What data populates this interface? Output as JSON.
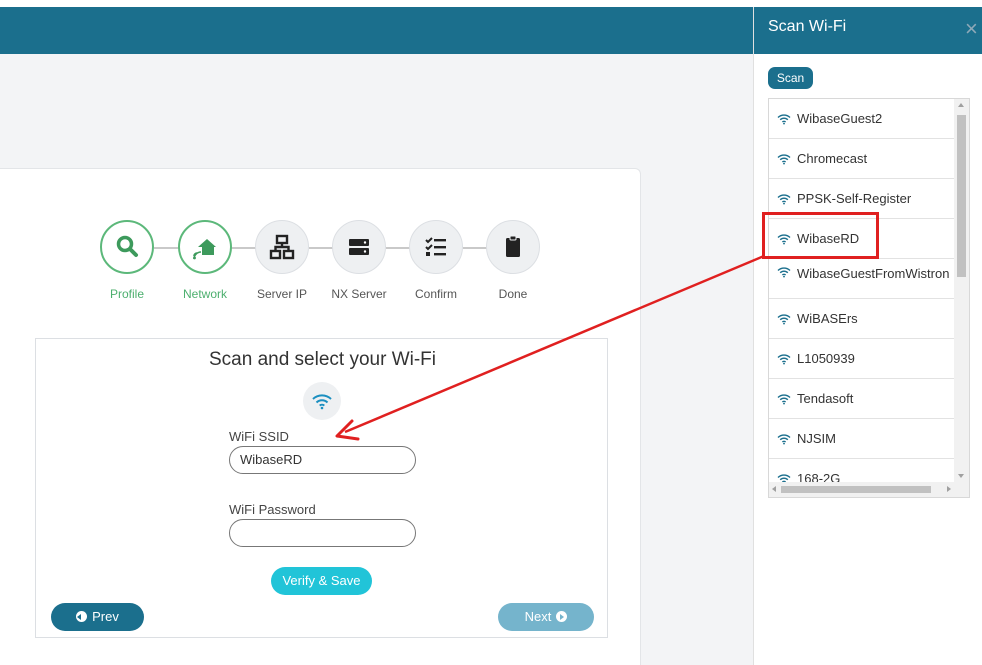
{
  "colors": {
    "brand": "#1b6f8d",
    "active_step": "#5cb87a",
    "accent_button": "#21c4d8",
    "annotation": "#e02020"
  },
  "stepper": [
    {
      "label": "Profile",
      "icon": "search-icon",
      "state": "active"
    },
    {
      "label": "Network",
      "icon": "network-home-icon",
      "state": "active"
    },
    {
      "label": "Server IP",
      "icon": "network-topology-icon",
      "state": "inactive"
    },
    {
      "label": "NX Server",
      "icon": "server-icon",
      "state": "inactive"
    },
    {
      "label": "Confirm",
      "icon": "checklist-icon",
      "state": "inactive"
    },
    {
      "label": "Done",
      "icon": "clipboard-icon",
      "state": "inactive"
    }
  ],
  "form": {
    "title": "Scan and select your Wi-Fi",
    "ssid_label": "WiFi SSID",
    "ssid_value": "WibaseRD",
    "password_label": "WiFi Password",
    "password_value": "",
    "verify_button": "Verify & Save",
    "prev_button": "Prev",
    "next_button": "Next"
  },
  "side_panel": {
    "title": "Scan Wi-Fi",
    "close": "×",
    "scan_button": "Scan",
    "networks": [
      "WibaseGuest2",
      "Chromecast",
      "PPSK-Self-Register",
      "WibaseRD",
      "WibaseGuestFromWistron",
      "WiBASErs",
      "L1050939",
      "Tendasoft",
      "NJSIM",
      "168-2G"
    ],
    "selected": "WibaseRD"
  }
}
